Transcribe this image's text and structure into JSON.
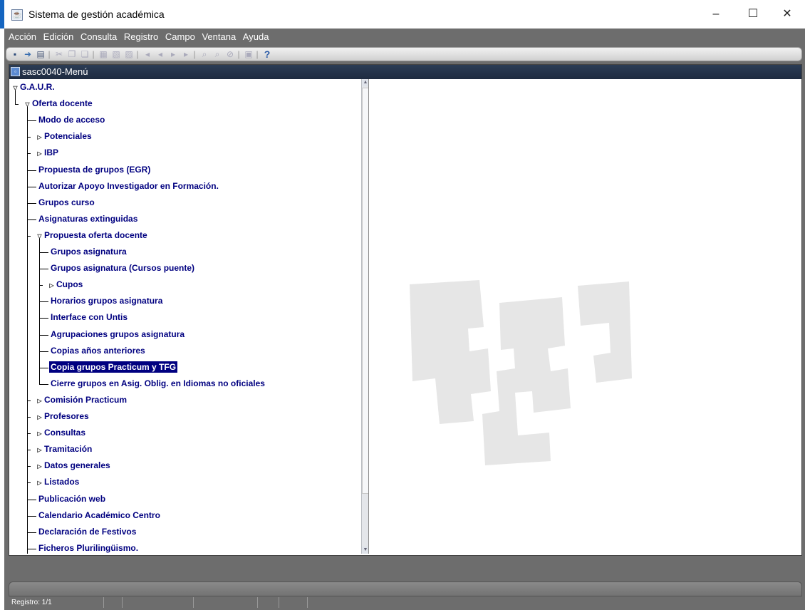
{
  "window": {
    "title": "Sistema de gestión académica",
    "minimize": "–",
    "maximize": "☐",
    "close": "✕"
  },
  "menubar": [
    "Acción",
    "Edición",
    "Consulta",
    "Registro",
    "Campo",
    "Ventana",
    "Ayuda"
  ],
  "toolbar_icons": [
    "save-icon",
    "exit-icon",
    "print-icon",
    "cut-icon",
    "copy-icon",
    "paste-icon",
    "insert-record-icon",
    "remove-record-icon",
    "duplicate-record-icon",
    "first-record-icon",
    "previous-record-icon",
    "next-record-icon",
    "last-record-icon",
    "enter-query-icon",
    "execute-query-icon",
    "cancel-query-icon",
    "list-icon",
    "help-icon"
  ],
  "inner_window": {
    "title": "sasc0040-Menú"
  },
  "tree": [
    {
      "label": "G.A.U.R.",
      "level": 0,
      "toggle": "expanded"
    },
    {
      "label": "Oferta docente",
      "level": 1,
      "toggle": "expanded"
    },
    {
      "label": "Modo de acceso",
      "level": 2,
      "toggle": "leaf"
    },
    {
      "label": "Potenciales",
      "level": 2,
      "toggle": "collapsed"
    },
    {
      "label": "IBP",
      "level": 2,
      "toggle": "collapsed"
    },
    {
      "label": "Propuesta de grupos (EGR)",
      "level": 2,
      "toggle": "leaf"
    },
    {
      "label": "Autorizar Apoyo Investigador en Formación.",
      "level": 2,
      "toggle": "leaf"
    },
    {
      "label": "Grupos curso",
      "level": 2,
      "toggle": "leaf"
    },
    {
      "label": "Asignaturas extinguidas",
      "level": 2,
      "toggle": "leaf"
    },
    {
      "label": "Propuesta oferta docente",
      "level": 2,
      "toggle": "expanded"
    },
    {
      "label": "Grupos asignatura",
      "level": 3,
      "toggle": "leaf"
    },
    {
      "label": "Grupos asignatura (Cursos puente)",
      "level": 3,
      "toggle": "leaf"
    },
    {
      "label": "Cupos",
      "level": 3,
      "toggle": "collapsed"
    },
    {
      "label": "Horarios grupos asignatura",
      "level": 3,
      "toggle": "leaf"
    },
    {
      "label": "Interface con Untis",
      "level": 3,
      "toggle": "leaf"
    },
    {
      "label": "Agrupaciones grupos asignatura",
      "level": 3,
      "toggle": "leaf"
    },
    {
      "label": "Copias años anteriores",
      "level": 3,
      "toggle": "leaf"
    },
    {
      "label": "Copia grupos Practicum y TFG",
      "level": 3,
      "toggle": "leaf",
      "selected": true
    },
    {
      "label": "Cierre grupos en Asig. Oblig. en Idiomas no oficiales",
      "level": 3,
      "toggle": "leaf"
    },
    {
      "label": "Comisión Practicum",
      "level": 2,
      "toggle": "collapsed"
    },
    {
      "label": "Profesores",
      "level": 2,
      "toggle": "collapsed"
    },
    {
      "label": "Consultas",
      "level": 2,
      "toggle": "collapsed"
    },
    {
      "label": "Tramitación",
      "level": 2,
      "toggle": "collapsed"
    },
    {
      "label": "Datos generales",
      "level": 2,
      "toggle": "collapsed"
    },
    {
      "label": "Listados",
      "level": 2,
      "toggle": "collapsed"
    },
    {
      "label": "Publicación  web",
      "level": 2,
      "toggle": "leaf"
    },
    {
      "label": "Calendario Académico Centro",
      "level": 2,
      "toggle": "leaf"
    },
    {
      "label": "Declaración de Festivos",
      "level": 2,
      "toggle": "leaf"
    },
    {
      "label": "Ficheros Plurilingüismo.",
      "level": 2,
      "toggle": "leaf"
    }
  ],
  "status": {
    "record": "Registro: 1/1"
  },
  "colors": {
    "accent": "#1565c0",
    "tree_text": "#000080",
    "selection": "#000080",
    "frame": "#6d6d6d",
    "logo": "#e6e6e6"
  }
}
